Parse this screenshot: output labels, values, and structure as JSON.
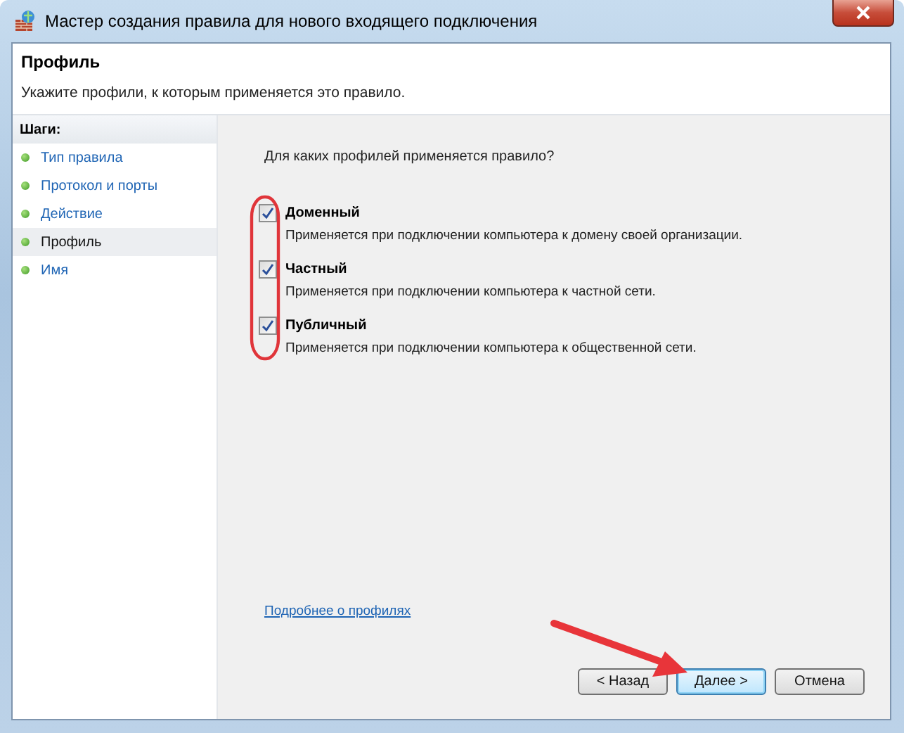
{
  "window": {
    "title": "Мастер создания правила для нового входящего подключения"
  },
  "header": {
    "title": "Профиль",
    "subtitle": "Укажите профили, к которым применяется это правило."
  },
  "steps": {
    "heading": "Шаги:",
    "items": [
      {
        "label": "Тип правила",
        "selected": false
      },
      {
        "label": "Протокол и порты",
        "selected": false
      },
      {
        "label": "Действие",
        "selected": false
      },
      {
        "label": "Профиль",
        "selected": true
      },
      {
        "label": "Имя",
        "selected": false
      }
    ]
  },
  "question": "Для каких профилей применяется правило?",
  "profiles": [
    {
      "label": "Доменный",
      "description": "Применяется при подключении компьютера к домену своей организации.",
      "checked": true
    },
    {
      "label": "Частный",
      "description": "Применяется при подключении компьютера к частной сети.",
      "checked": true
    },
    {
      "label": "Публичный",
      "description": "Применяется при подключении компьютера к общественной сети.",
      "checked": true
    }
  ],
  "link": "Подробнее о профилях",
  "buttons": [
    {
      "label": "< Назад",
      "default": false
    },
    {
      "label": "Далее >",
      "default": true
    },
    {
      "label": "Отмена",
      "default": false
    }
  ],
  "annotations": {
    "highlight_oval": true,
    "pointer_arrow": true
  }
}
